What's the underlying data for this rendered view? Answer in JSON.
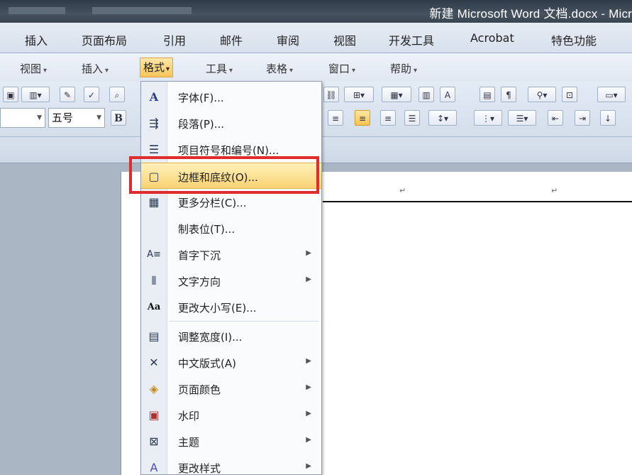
{
  "window": {
    "title": "新建 Microsoft Word 文档.docx - Micr"
  },
  "ribbon_tabs": [
    {
      "label": "插入"
    },
    {
      "label": "页面布局"
    },
    {
      "label": "引用"
    },
    {
      "label": "邮件"
    },
    {
      "label": "审阅"
    },
    {
      "label": "视图"
    },
    {
      "label": "开发工具"
    },
    {
      "label": "Acrobat"
    },
    {
      "label": "特色功能"
    }
  ],
  "menubar": [
    {
      "label": "视图"
    },
    {
      "label": "插入"
    },
    {
      "label": "格式"
    },
    {
      "label": "工具"
    },
    {
      "label": "表格"
    },
    {
      "label": "窗口"
    },
    {
      "label": "帮助"
    }
  ],
  "toolbar": {
    "font_size": "五号",
    "bold": "B"
  },
  "format_menu": {
    "items": [
      {
        "label": "字体(F)...",
        "icon": "font-A-icon",
        "submenu": false
      },
      {
        "label": "段落(P)...",
        "icon": "paragraph-icon",
        "submenu": false
      },
      {
        "label": "项目符号和编号(N)...",
        "icon": "bullets-numbering-icon",
        "submenu": false
      },
      {
        "label": "边框和底纹(O)...",
        "icon": "borders-shading-icon",
        "submenu": false,
        "highlighted": true
      },
      {
        "label": "更多分栏(C)...",
        "icon": "columns-icon",
        "submenu": false
      },
      {
        "label": "制表位(T)...",
        "icon": "",
        "submenu": false
      },
      {
        "label": "首字下沉",
        "icon": "drop-cap-icon",
        "submenu": true
      },
      {
        "label": "文字方向",
        "icon": "text-direction-icon",
        "submenu": true
      },
      {
        "label": "更改大小写(E)...",
        "icon": "change-case-icon",
        "submenu": false
      },
      {
        "label": "调整宽度(I)...",
        "icon": "adjust-width-icon",
        "submenu": false
      },
      {
        "label": "中文版式(A)",
        "icon": "asian-layout-icon",
        "submenu": true
      },
      {
        "label": "页面颜色",
        "icon": "page-color-icon",
        "submenu": true
      },
      {
        "label": "水印",
        "icon": "watermark-icon",
        "submenu": true
      },
      {
        "label": "主题",
        "icon": "theme-icon",
        "submenu": true
      },
      {
        "label": "更改样式",
        "icon": "change-styles-icon",
        "submenu": true
      }
    ]
  },
  "colors": {
    "highlight": "#f8d374",
    "annotation": "#e02c2c",
    "titlebar": "#3a4552"
  }
}
